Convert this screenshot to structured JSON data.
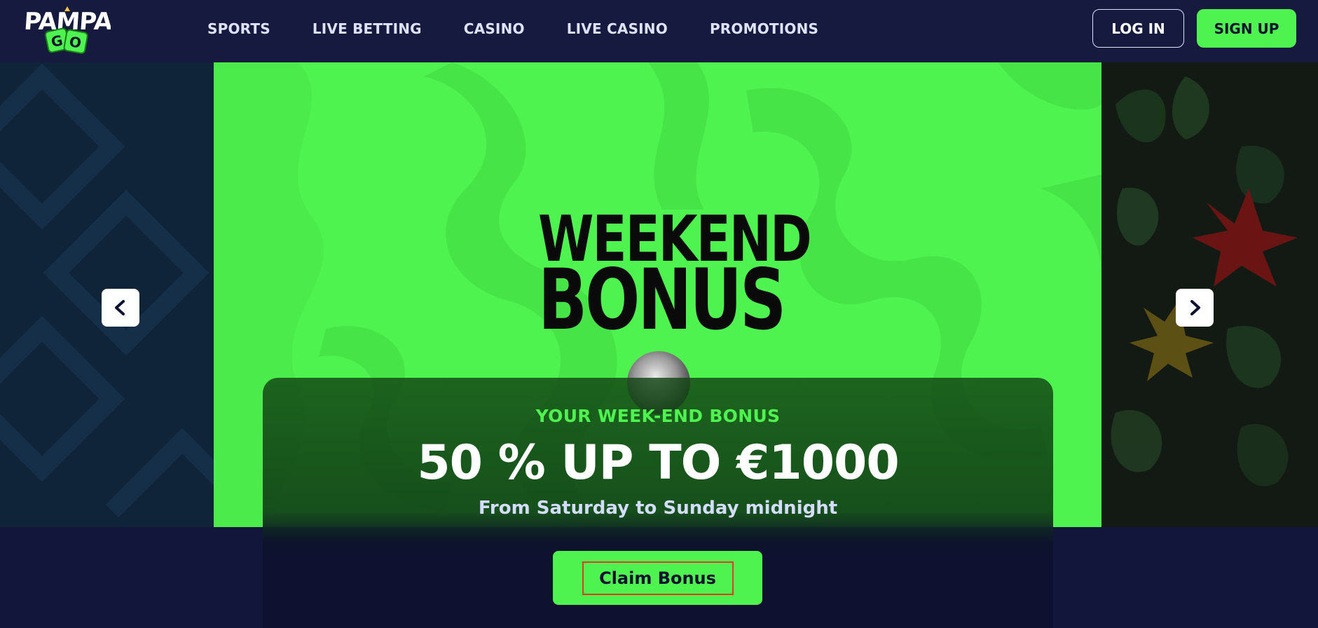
{
  "brand": {
    "name": "PampaGo",
    "logo_top": "PAMPA",
    "logo_bottom": "GO",
    "accent_color": "#4ff34f",
    "header_bg": "#161a3f"
  },
  "nav": {
    "items": [
      {
        "label": "SPORTS"
      },
      {
        "label": "LIVE BETTING"
      },
      {
        "label": "CASINO"
      },
      {
        "label": "LIVE CASINO"
      },
      {
        "label": "PROMOTIONS"
      }
    ]
  },
  "auth": {
    "login_label": "LOG IN",
    "signup_label": "SIGN UP"
  },
  "carousel": {
    "prev_icon": "chevron-left-icon",
    "next_icon": "chevron-right-icon",
    "slide": {
      "title_line1": "WEEKEND",
      "title_line2": "BONUS",
      "subtitle": "YOUR WEEK-END BONUS",
      "headline": "50 % UP TO €1000",
      "description": "From Saturday to Sunday midnight",
      "cta_label": "Claim Bonus"
    }
  }
}
